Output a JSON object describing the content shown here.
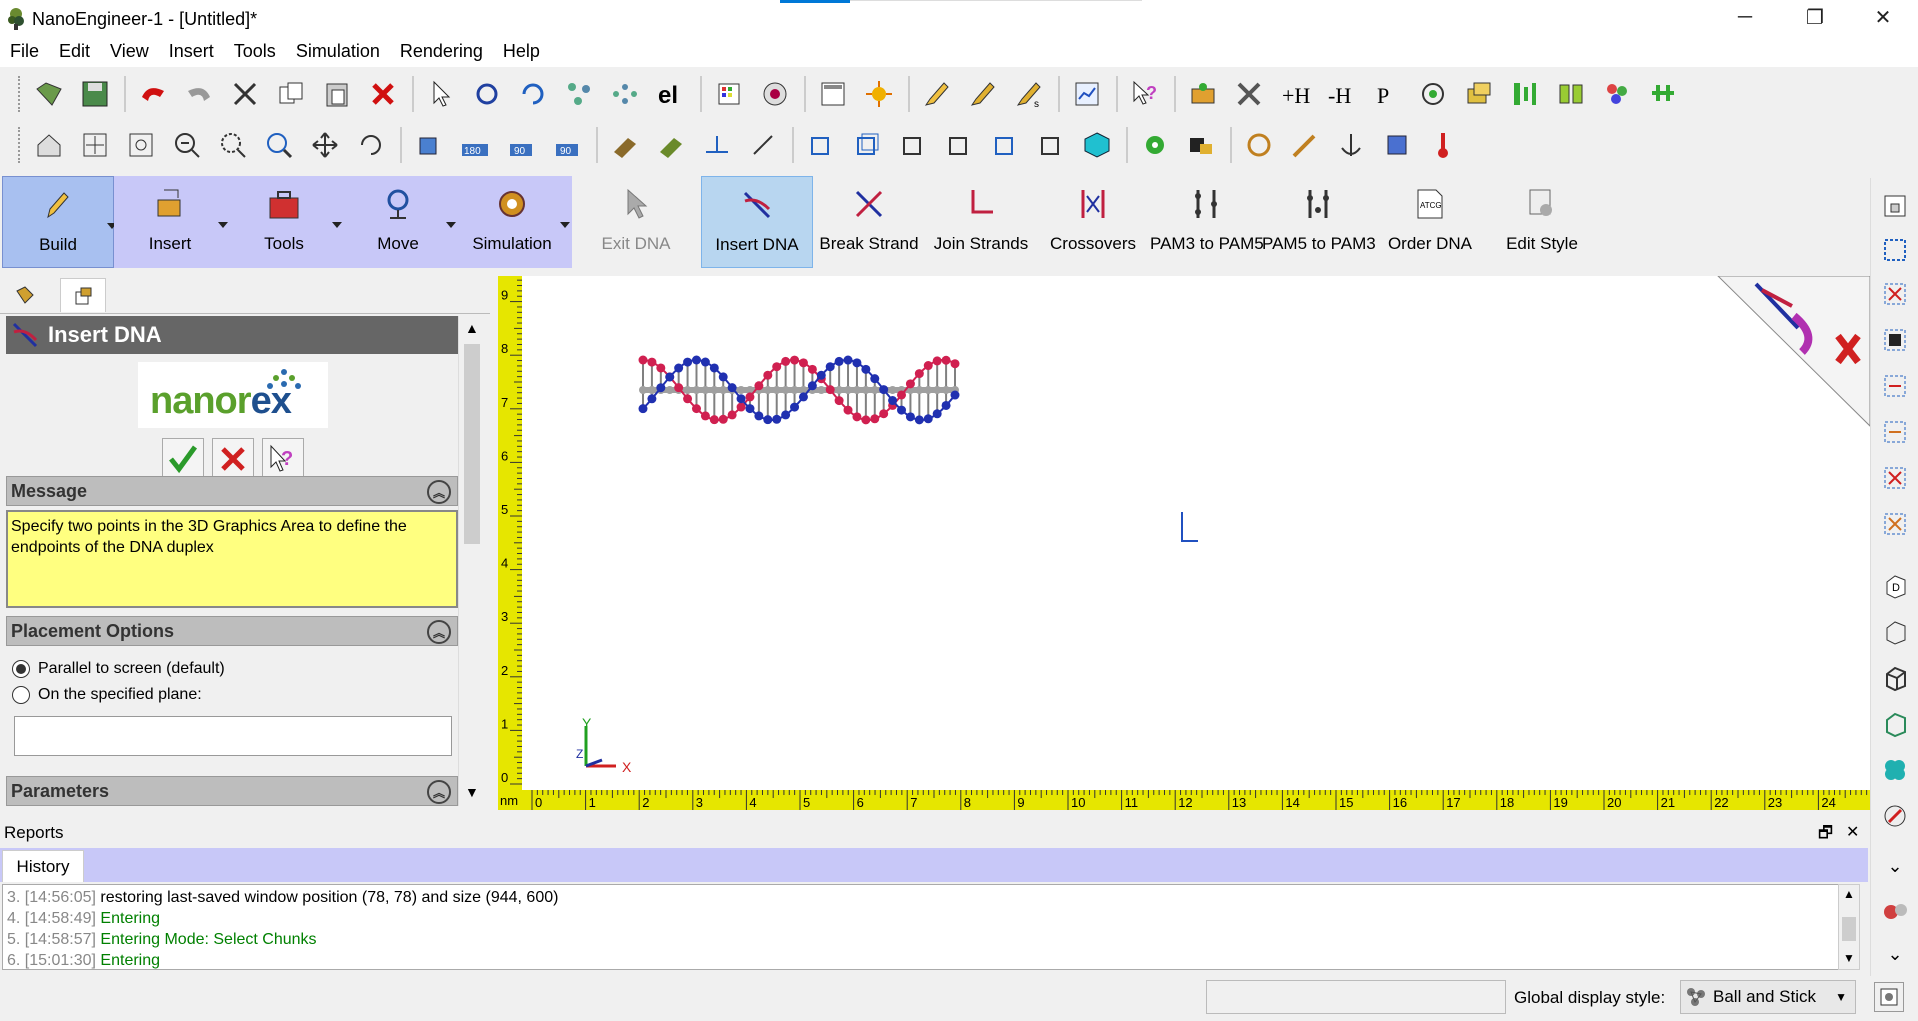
{
  "window": {
    "title": "NanoEngineer-1 - [Untitled]*",
    "minimize": "─",
    "restore": "❐",
    "close": "✕"
  },
  "menus": [
    "File",
    "Edit",
    "View",
    "Insert",
    "Tools",
    "Simulation",
    "Rendering",
    "Help"
  ],
  "command_toolbar": {
    "groups": [
      {
        "label": "Build",
        "icon": "build-icon"
      },
      {
        "label": "Insert",
        "icon": "insert-icon"
      },
      {
        "label": "Tools",
        "icon": "tools-icon"
      },
      {
        "label": "Move",
        "icon": "move-icon"
      },
      {
        "label": "Simulation",
        "icon": "simulation-icon"
      }
    ],
    "commands": [
      {
        "label": "Exit DNA",
        "state": "disabled"
      },
      {
        "label": "Insert DNA",
        "state": "active"
      },
      {
        "label": "Break Strand",
        "state": "normal"
      },
      {
        "label": "Join Strands",
        "state": "normal"
      },
      {
        "label": "Crossovers",
        "state": "normal"
      },
      {
        "label": "PAM3 to PAM5",
        "state": "normal"
      },
      {
        "label": "PAM5 to PAM3",
        "state": "normal"
      },
      {
        "label": "Order DNA",
        "state": "normal"
      },
      {
        "label": "Edit Style",
        "state": "normal"
      }
    ]
  },
  "property_manager": {
    "title": "Insert DNA",
    "logo_text": "nanorex",
    "message_group": "Message",
    "message_text": "Specify two points in the 3D Graphics Area to define the endpoints of the DNA duplex",
    "placement_group": "Placement Options",
    "placement_options": [
      {
        "label": "Parallel to screen (default)",
        "selected": true
      },
      {
        "label": "On the specified plane:",
        "selected": false
      }
    ],
    "parameters_group": "Parameters"
  },
  "graphics": {
    "ruler_unit": "nm",
    "x_ticks": [
      "0",
      "1",
      "2",
      "3",
      "4",
      "5",
      "6",
      "7",
      "8",
      "9",
      "10",
      "11",
      "12",
      "13",
      "14",
      "15",
      "16",
      "17",
      "18",
      "19",
      "20",
      "21",
      "22",
      "23",
      "24"
    ],
    "y_ticks": [
      "0",
      "1",
      "2",
      "3",
      "4",
      "5",
      "6",
      "7",
      "8",
      "9"
    ],
    "axis_x": "X",
    "axis_y": "Y",
    "axis_z": "Z",
    "strand_colors": {
      "strand1": "#d02050",
      "strand2": "#2030b0",
      "axis": "#a0a0a0",
      "backbone": "#808080"
    }
  },
  "reports": {
    "label": "Reports",
    "tab": "History",
    "entries": [
      {
        "num": "3.",
        "time": "[14:56:05]",
        "text": "restoring last-saved window position (78, 78) and size (944, 600)",
        "color": "black"
      },
      {
        "num": "4.",
        "time": "[14:58:49]",
        "text": "Entering",
        "color": "green"
      },
      {
        "num": "5.",
        "time": "[14:58:57]",
        "text": "Entering Mode: Select Chunks",
        "color": "green"
      },
      {
        "num": "6.",
        "time": "[15:01:30]",
        "text": "Entering",
        "color": "green"
      }
    ]
  },
  "status": {
    "global_display_label": "Global display style:",
    "global_display_value": "Ball and Stick"
  }
}
